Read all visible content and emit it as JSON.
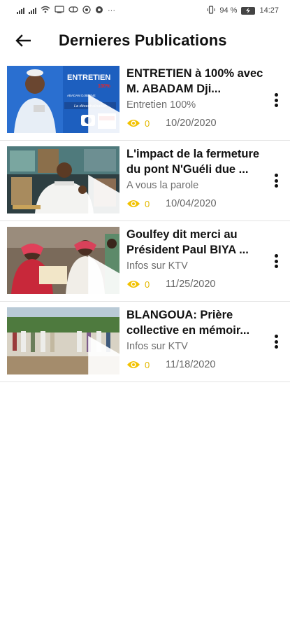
{
  "status_bar": {
    "battery_percent": "94 %",
    "battery_icon_text": "",
    "time": "14:27",
    "more": "···"
  },
  "app_bar": {
    "title": "Dernieres Publications",
    "back_icon": "arrow-left-icon"
  },
  "colors": {
    "accent": "#f2c200",
    "title_text": "#111111",
    "secondary_text": "#6f6f6f",
    "divider": "#e3e3e3"
  },
  "publications": [
    {
      "title": "ENTRETIEN à 100% avec M. ABADAM Dji...",
      "category": "Entretien 100%",
      "views": "0",
      "date": "10/20/2020",
      "thumb_text": {
        "headline": "ENTRETIEN",
        "sub": "100%",
        "name": "ABADAM DJIBRINE",
        "topic": "La décentralisation"
      }
    },
    {
      "title": "L'impact de la fermeture du pont N'Guéli due ...",
      "category": "A vous la parole",
      "views": "0",
      "date": "10/04/2020"
    },
    {
      "title": "Goulfey dit merci au Président Paul BIYA ...",
      "category": "Infos sur KTV",
      "views": "0",
      "date": "11/25/2020"
    },
    {
      "title": "BLANGOUA: Prière collective en mémoir...",
      "category": "Infos sur KTV",
      "views": "0",
      "date": "11/18/2020"
    }
  ]
}
